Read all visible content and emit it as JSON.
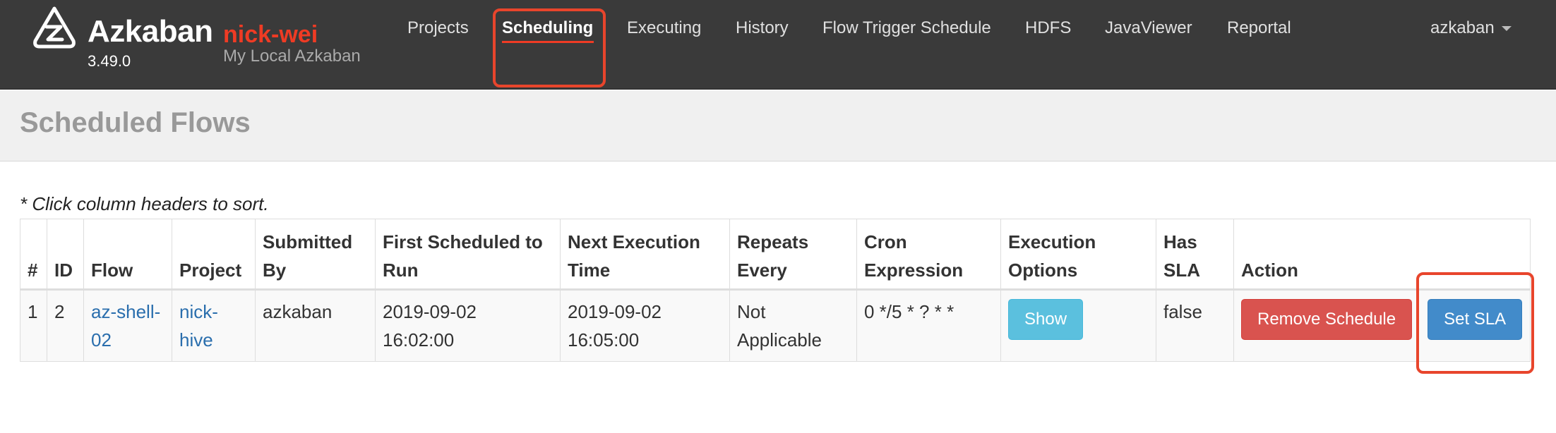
{
  "brand": {
    "name": "Azkaban",
    "env": "nick-wei",
    "version": "3.49.0",
    "subtitle": "My Local Azkaban"
  },
  "nav": {
    "items": [
      "Projects",
      "Scheduling",
      "Executing",
      "History",
      "Flow Trigger Schedule",
      "HDFS",
      "JavaViewer",
      "Reportal"
    ],
    "active": "Scheduling",
    "user": "azkaban"
  },
  "page": {
    "title": "Scheduled Flows",
    "sort_note": "* Click column headers to sort."
  },
  "table": {
    "headers": [
      "#",
      "ID",
      "Flow",
      "Project",
      "Submitted By",
      "First Scheduled to Run",
      "Next Execution Time",
      "Repeats Every",
      "Cron Expression",
      "Execution Options",
      "Has SLA",
      "Action"
    ],
    "rows": [
      {
        "num": "1",
        "id": "2",
        "flow": "az-shell-02",
        "project": "nick-hive",
        "submitted_by": "azkaban",
        "first_scheduled": "2019-09-02 16:02:00",
        "next_execution": "2019-09-02 16:05:00",
        "repeats": "Not Applicable",
        "cron": "0 */5 * ? * *",
        "exec_options_label": "Show",
        "has_sla": "false",
        "remove_label": "Remove Schedule",
        "set_sla_label": "Set SLA"
      }
    ]
  },
  "colors": {
    "navbar": "#3a3a3a",
    "accent": "#ef3b24",
    "link": "#2a6ead",
    "info": "#5bc0de",
    "danger": "#d9534f",
    "primary": "#428bca",
    "highlight": "#e8452c"
  },
  "icons": {
    "logo": "azkaban-logo-icon",
    "user_caret": "chevron-down-icon"
  }
}
